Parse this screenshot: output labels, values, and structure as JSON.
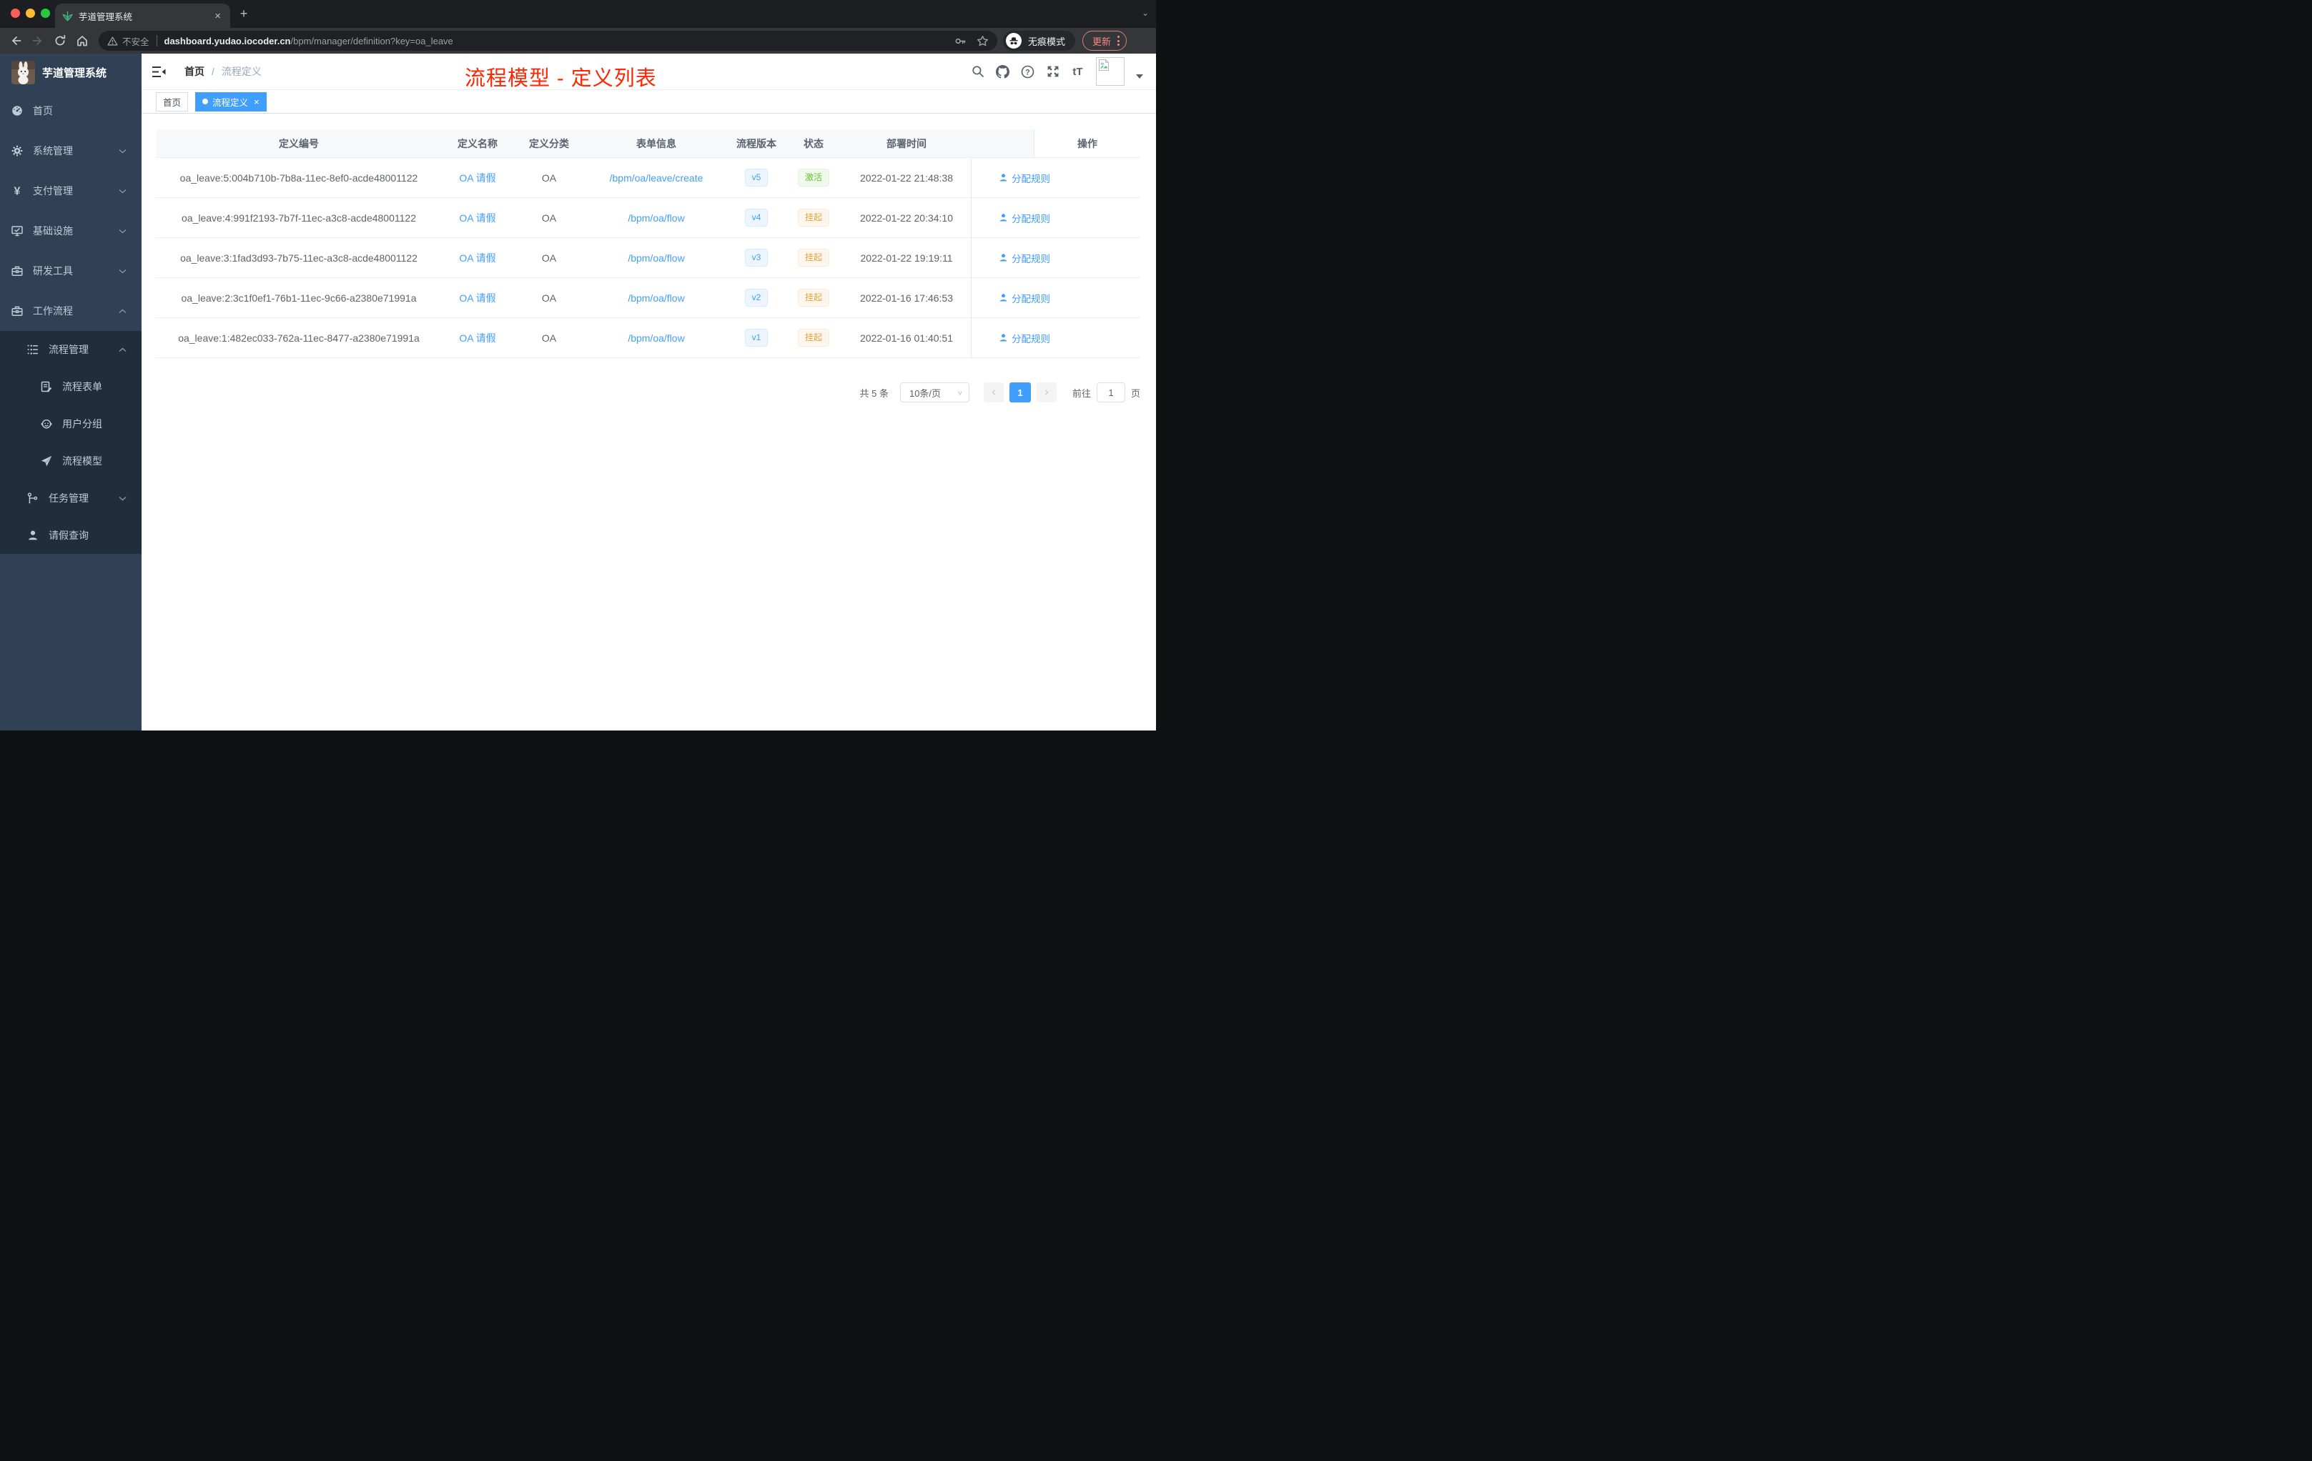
{
  "browser": {
    "tab_title": "芋道管理系统",
    "security_label": "不安全",
    "url_host": "dashboard.yudao.iocoder.cn",
    "url_path": "/bpm/manager/definition?key=oa_leave",
    "incognito_label": "无痕模式",
    "update_label": "更新"
  },
  "icons": {
    "tab_close": "×",
    "new_tab": "+",
    "tab_search_chevron": "⌄",
    "prev_arrow": "‹",
    "next_arrow": "›",
    "select_chevron": "∨",
    "tag_close": "×",
    "help_mark": "?",
    "yen": "¥",
    "font_size": "tT"
  },
  "sidebar": {
    "logo_title": "芋道管理系统",
    "menu": [
      {
        "label": "首页",
        "icon": "dashboard-icon"
      },
      {
        "label": "系统管理",
        "icon": "gear-icon"
      },
      {
        "label": "支付管理",
        "icon": "yen-icon"
      },
      {
        "label": "基础设施",
        "icon": "monitor-icon"
      },
      {
        "label": "研发工具",
        "icon": "toolbox-icon"
      },
      {
        "label": "工作流程",
        "icon": "briefcase-icon"
      },
      {
        "label": "流程管理",
        "icon": "process-list-icon"
      },
      {
        "label": "流程表单",
        "icon": "form-icon"
      },
      {
        "label": "用户分组",
        "icon": "robot-icon"
      },
      {
        "label": "流程模型",
        "icon": "send-icon"
      },
      {
        "label": "任务管理",
        "icon": "tree-icon"
      },
      {
        "label": "请假查询",
        "icon": "user-icon"
      }
    ]
  },
  "header": {
    "breadcrumb_home": "首页",
    "breadcrumb_separator": "/",
    "breadcrumb_current": "流程定义",
    "annotation": "流程模型 - 定义列表"
  },
  "tags": {
    "home": "首页",
    "active": "流程定义"
  },
  "table": {
    "headers": [
      "定义编号",
      "定义名称",
      "定义分类",
      "表单信息",
      "流程版本",
      "状态",
      "部署时间",
      "操作"
    ],
    "rows": [
      {
        "id": "oa_leave:5:004b710b-7b8a-11ec-8ef0-acde48001122",
        "name": "OA 请假",
        "category": "OA",
        "form": "/bpm/oa/leave/create",
        "version": "v5",
        "status": "激活",
        "status_type": "success",
        "deployed_at": "2022-01-22 21:48:38",
        "action": "分配规则"
      },
      {
        "id": "oa_leave:4:991f2193-7b7f-11ec-a3c8-acde48001122",
        "name": "OA 请假",
        "category": "OA",
        "form": "/bpm/oa/flow",
        "version": "v4",
        "status": "挂起",
        "status_type": "warning",
        "deployed_at": "2022-01-22 20:34:10",
        "action": "分配规则"
      },
      {
        "id": "oa_leave:3:1fad3d93-7b75-11ec-a3c8-acde48001122",
        "name": "OA 请假",
        "category": "OA",
        "form": "/bpm/oa/flow",
        "version": "v3",
        "status": "挂起",
        "status_type": "warning",
        "deployed_at": "2022-01-22 19:19:11",
        "action": "分配规则"
      },
      {
        "id": "oa_leave:2:3c1f0ef1-76b1-11ec-9c66-a2380e71991a",
        "name": "OA 请假",
        "category": "OA",
        "form": "/bpm/oa/flow",
        "version": "v2",
        "status": "挂起",
        "status_type": "warning",
        "deployed_at": "2022-01-16 17:46:53",
        "action": "分配规则"
      },
      {
        "id": "oa_leave:1:482ec033-762a-11ec-8477-a2380e71991a",
        "name": "OA 请假",
        "category": "OA",
        "form": "/bpm/oa/flow",
        "version": "v1",
        "status": "挂起",
        "status_type": "warning",
        "deployed_at": "2022-01-16 01:40:51",
        "action": "分配规则"
      }
    ]
  },
  "pagination": {
    "total": "共 5 条",
    "page_size": "10条/页",
    "page": "1",
    "goto_label": "前往",
    "goto_value": "1",
    "unit_label": "页"
  },
  "colors": {
    "primary": "#409eff",
    "success": "#67c23a",
    "warning": "#e6a23c",
    "annotation_red": "#ff2601",
    "sidebar_bg": "#304156",
    "submenu_bg": "#1f2d3d"
  }
}
